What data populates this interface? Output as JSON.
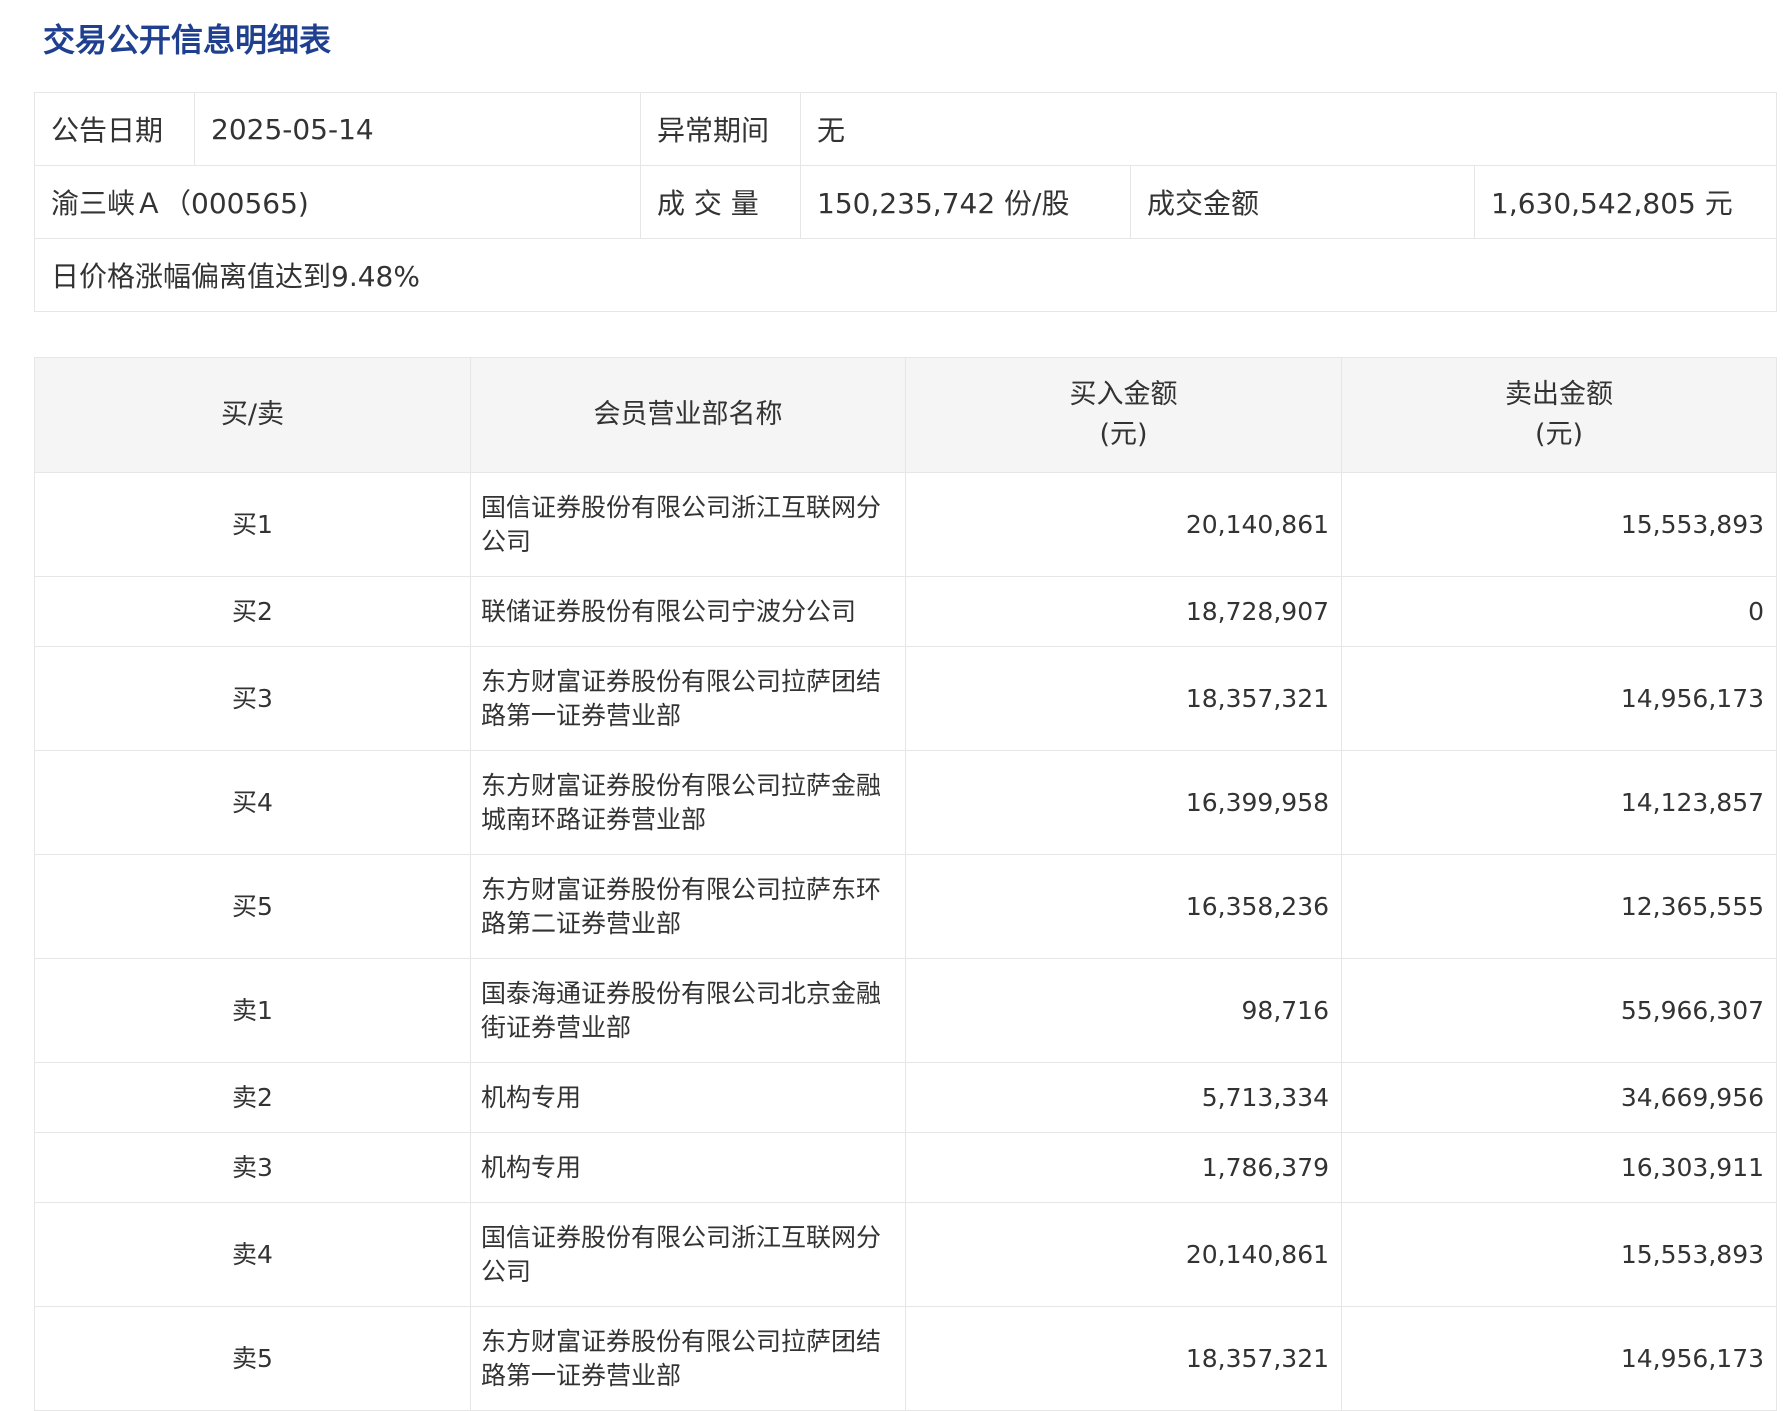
{
  "title": "交易公开信息明细表",
  "info": {
    "announce_date_label": "公告日期",
    "announce_date": "2025-05-14",
    "abnormal_period_label": "异常期间",
    "abnormal_period": "无",
    "stock": "渝三峡Ａ（000565)",
    "volume_label": "成 交 量",
    "volume": "150,235,742 份/股",
    "amount_label": "成交金额",
    "amount": "1,630,542,805 元",
    "reason": "日价格涨幅偏离值达到9.48%"
  },
  "table": {
    "headers": {
      "side": "买/卖",
      "name": "会员营业部名称",
      "buy_line1": "买入金额",
      "buy_line2": "(元)",
      "sell_line1": "卖出金额",
      "sell_line2": "(元)"
    },
    "rows": [
      {
        "side": "买1",
        "name": "国信证券股份有限公司浙江互联网分公司",
        "buy": "20,140,861",
        "sell": "15,553,893"
      },
      {
        "side": "买2",
        "name": "联储证券股份有限公司宁波分公司",
        "buy": "18,728,907",
        "sell": "0"
      },
      {
        "side": "买3",
        "name": "东方财富证券股份有限公司拉萨团结路第一证券营业部",
        "buy": "18,357,321",
        "sell": "14,956,173"
      },
      {
        "side": "买4",
        "name": "东方财富证券股份有限公司拉萨金融城南环路证券营业部",
        "buy": "16,399,958",
        "sell": "14,123,857"
      },
      {
        "side": "买5",
        "name": "东方财富证券股份有限公司拉萨东环路第二证券营业部",
        "buy": "16,358,236",
        "sell": "12,365,555"
      },
      {
        "side": "卖1",
        "name": "国泰海通证券股份有限公司北京金融街证券营业部",
        "buy": "98,716",
        "sell": "55,966,307"
      },
      {
        "side": "卖2",
        "name": "机构专用",
        "buy": "5,713,334",
        "sell": "34,669,956"
      },
      {
        "side": "卖3",
        "name": "机构专用",
        "buy": "1,786,379",
        "sell": "16,303,911"
      },
      {
        "side": "卖4",
        "name": "国信证券股份有限公司浙江互联网分公司",
        "buy": "20,140,861",
        "sell": "15,553,893"
      },
      {
        "side": "卖5",
        "name": "东方财富证券股份有限公司拉萨团结路第一证券营业部",
        "buy": "18,357,321",
        "sell": "14,956,173"
      }
    ]
  }
}
